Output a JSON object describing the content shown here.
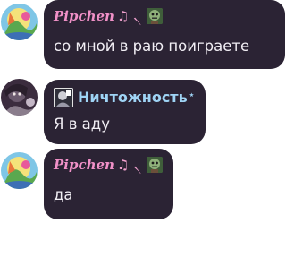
{
  "messages": [
    {
      "author": "Pipchen",
      "author_decoration": "♫ ৲ ",
      "badge_icon": "zombie-emoji-icon",
      "text": "со мной в раю поиграете"
    },
    {
      "author": "Ничтожность",
      "author_decoration": "⭑",
      "author_icon": "user-emblem-icon",
      "text": "Я в аду"
    },
    {
      "author": "Pipchen",
      "author_decoration": "♫ ৲ ",
      "badge_icon": "zombie-emoji-icon",
      "text": "да"
    }
  ],
  "colors": {
    "bubble_bg": "#2b2334",
    "text": "#f1eef4",
    "name_pink": "#f191c8",
    "name_blue": "#9fd4f5"
  }
}
